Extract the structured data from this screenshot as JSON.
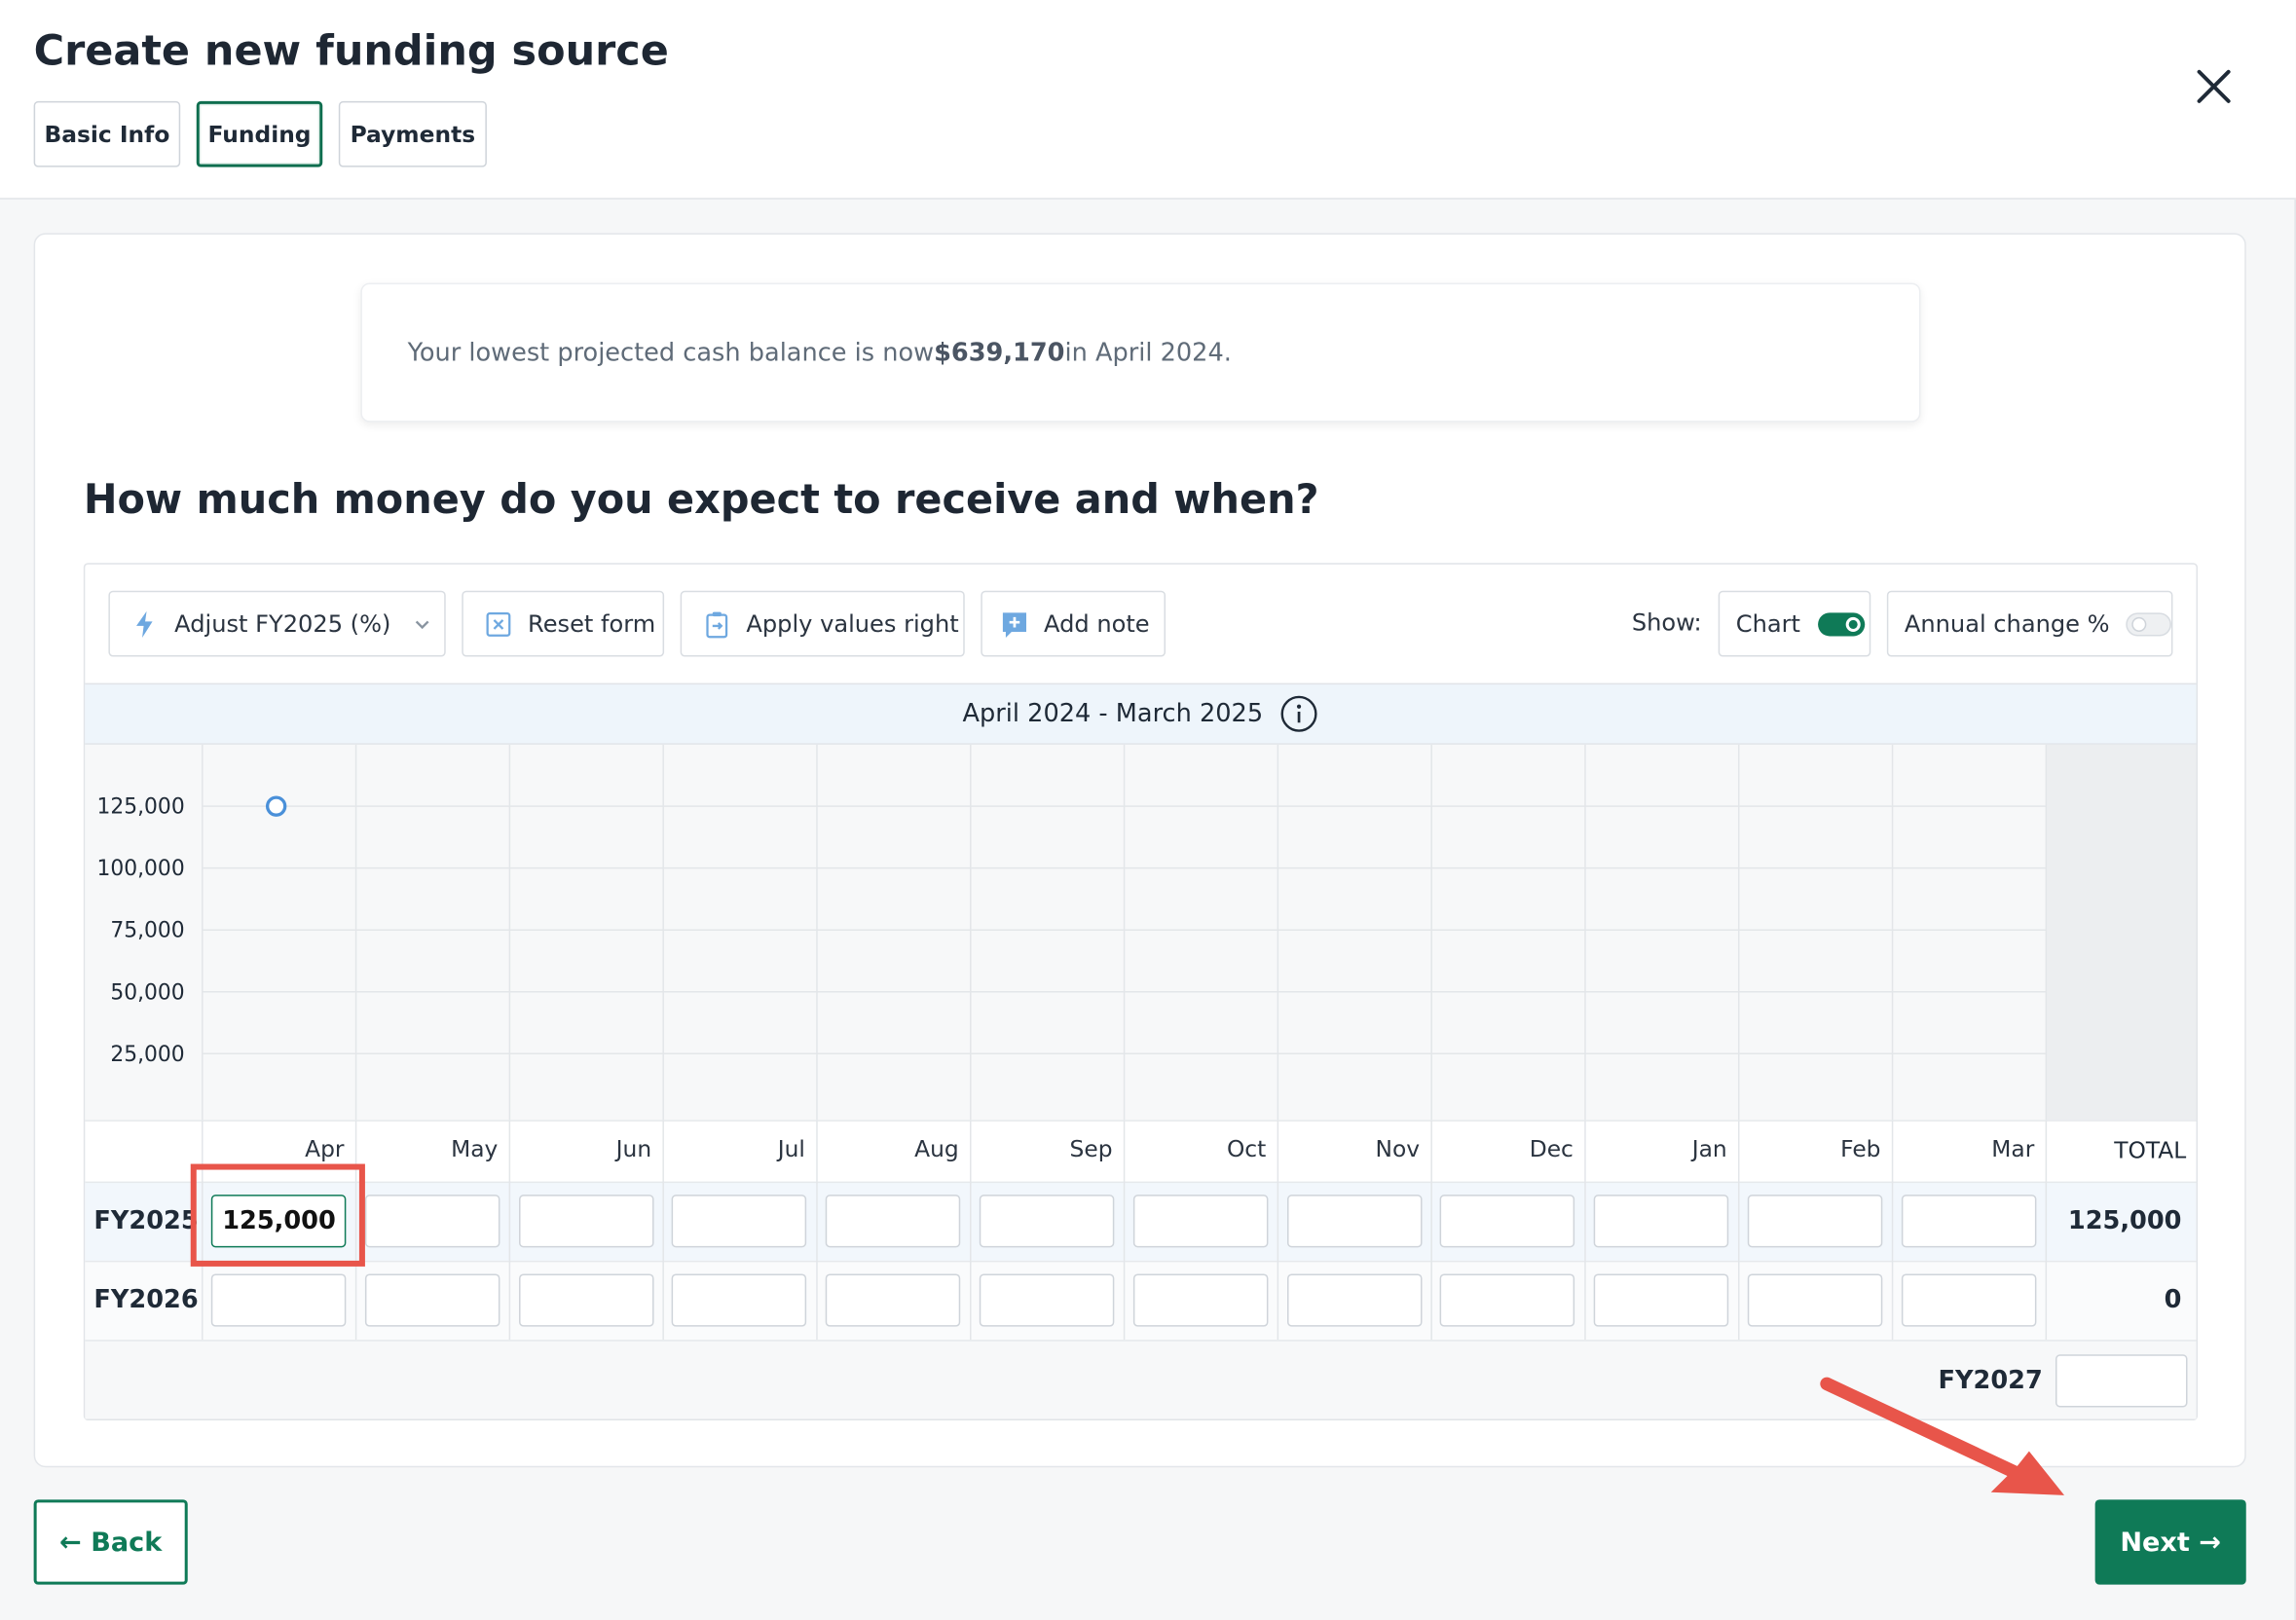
{
  "header": {
    "title": "Create new funding source",
    "tabs": [
      {
        "label": "Basic Info",
        "active": false
      },
      {
        "label": "Funding",
        "active": true
      },
      {
        "label": "Payments",
        "active": false
      }
    ],
    "close_icon": "close-icon"
  },
  "notice": {
    "prefix": "Your lowest projected cash balance is now ",
    "amount": "$639,170",
    "suffix": " in April 2024."
  },
  "question": "How much money do you expect to receive and when?",
  "toolbar": {
    "adjust_label": "Adjust FY2025 (%)",
    "reset_label": "Reset form",
    "apply_label": "Apply values right",
    "note_label": "Add note",
    "show_label": "Show:",
    "chart_label": "Chart",
    "chart_on": true,
    "annual_label": "Annual change %",
    "annual_on": false
  },
  "period": "April 2024 - March 2025",
  "chart_data": {
    "type": "scatter",
    "categories": [
      "Apr",
      "May",
      "Jun",
      "Jul",
      "Aug",
      "Sep",
      "Oct",
      "Nov",
      "Dec",
      "Jan",
      "Feb",
      "Mar"
    ],
    "values": [
      125000,
      null,
      null,
      null,
      null,
      null,
      null,
      null,
      null,
      null,
      null,
      null
    ],
    "y_ticks": [
      "125,000",
      "100,000",
      "75,000",
      "50,000",
      "25,000"
    ],
    "ylim": [
      0,
      125000
    ],
    "grid": true,
    "point_color": "#4a90d9"
  },
  "table": {
    "months": [
      "Apr",
      "May",
      "Jun",
      "Jul",
      "Aug",
      "Sep",
      "Oct",
      "Nov",
      "Dec",
      "Jan",
      "Feb",
      "Mar"
    ],
    "total_header": "TOTAL",
    "rows": [
      {
        "label": "FY2025",
        "values": [
          "125,000",
          "",
          "",
          "",
          "",
          "",
          "",
          "",
          "",
          "",
          "",
          ""
        ],
        "total": "125,000"
      },
      {
        "label": "FY2026",
        "values": [
          "",
          "",
          "",
          "",
          "",
          "",
          "",
          "",
          "",
          "",
          "",
          ""
        ],
        "total": "0"
      }
    ],
    "fy2027_label": "FY2027",
    "fy2027_value": ""
  },
  "footer": {
    "back_label": "← Back",
    "next_label": "Next →"
  },
  "colors": {
    "brand_green": "#0f7a57",
    "highlight_red": "#e8554a",
    "period_bar": "#eef5fb"
  }
}
